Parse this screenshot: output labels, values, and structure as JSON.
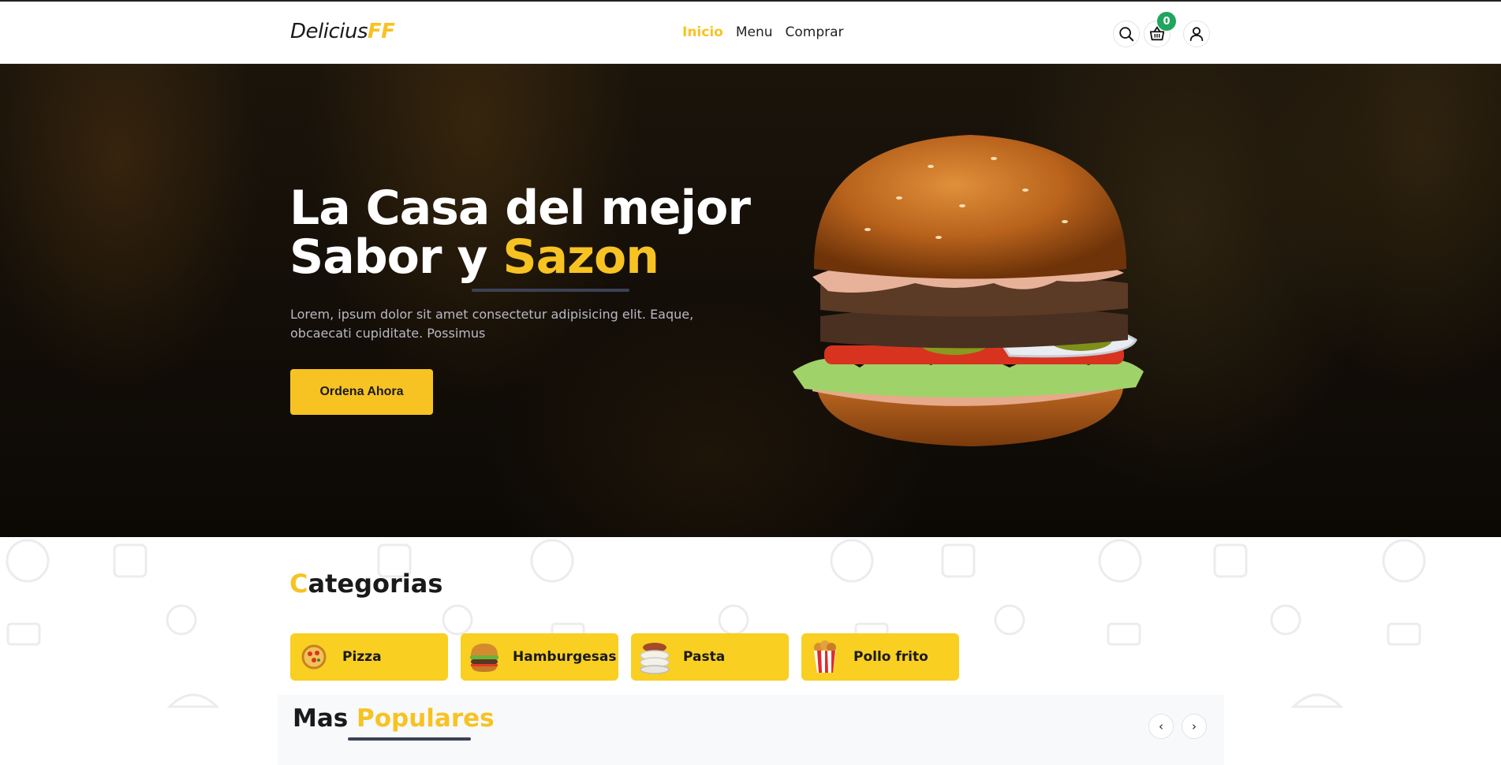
{
  "header": {
    "logo_main": "Delicius",
    "logo_accent": "FF",
    "nav": [
      {
        "label": "Inicio",
        "active": true
      },
      {
        "label": "Menu",
        "active": false
      },
      {
        "label": "Comprar",
        "active": false
      }
    ],
    "cart_count": "0",
    "icons": [
      "search-icon",
      "basket-icon",
      "user-icon"
    ]
  },
  "hero": {
    "title_line1": "La Casa del mejor",
    "title_line2_start": "Sabor y ",
    "title_line2_highlight": "Sazon",
    "description": "Lorem, ipsum dolor sit amet consectetur adipisicing elit. Eaque, obcaecati cupiditate. Possimus",
    "cta_label": "Ordena Ahora"
  },
  "categories": {
    "title_first_letter": "C",
    "title_rest": "ategorias",
    "items": [
      {
        "label": "Pizza",
        "icon": "pizza-icon"
      },
      {
        "label": "Hamburgesas",
        "icon": "burger-icon"
      },
      {
        "label": "Pasta",
        "icon": "pasta-icon"
      },
      {
        "label": "Pollo frito",
        "icon": "fried-chicken-icon"
      }
    ]
  },
  "popular": {
    "title_start": "Mas ",
    "title_highlight": "Populares",
    "prev_label": "‹",
    "next_label": "›"
  },
  "colors": {
    "accent": "#f7c323",
    "badge": "#1fa55c",
    "underline": "#3b4257"
  }
}
